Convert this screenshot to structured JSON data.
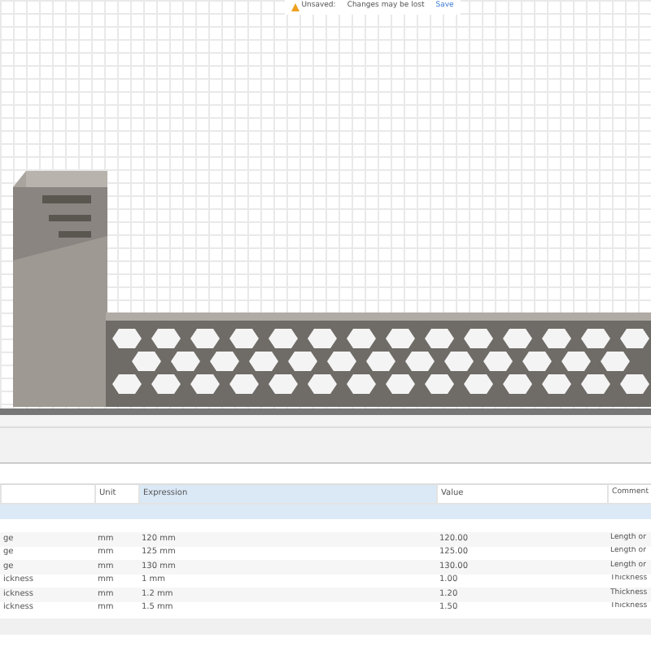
{
  "notice": {
    "status": "Unsaved:",
    "message": "Changes may be lost",
    "action": "Save"
  },
  "parameters": {
    "columns": [
      {
        "label": "Unit",
        "selected": false
      },
      {
        "label": "Expression",
        "selected": true
      },
      {
        "label": "Value",
        "selected": false
      },
      {
        "label": "Comment",
        "selected": false
      }
    ],
    "rows": [
      {
        "name": "ge",
        "unit": "mm",
        "expression": "120 mm",
        "value": "120.00",
        "comment": "Length or"
      },
      {
        "name": "ge",
        "unit": "mm",
        "expression": "125 mm",
        "value": "125.00",
        "comment": "Length or"
      },
      {
        "name": "ge",
        "unit": "mm",
        "expression": "130 mm",
        "value": "130.00",
        "comment": "Length or"
      },
      {
        "name": "ickness",
        "unit": "mm",
        "expression": "1 mm",
        "value": "1.00",
        "comment": "Thickness"
      },
      {
        "name": "ickness",
        "unit": "mm",
        "expression": "1.2 mm",
        "value": "1.20",
        "comment": "Thickness"
      },
      {
        "name": "ickness",
        "unit": "mm",
        "expression": "1.5 mm",
        "value": "1.50",
        "comment": "Thickness"
      }
    ]
  }
}
